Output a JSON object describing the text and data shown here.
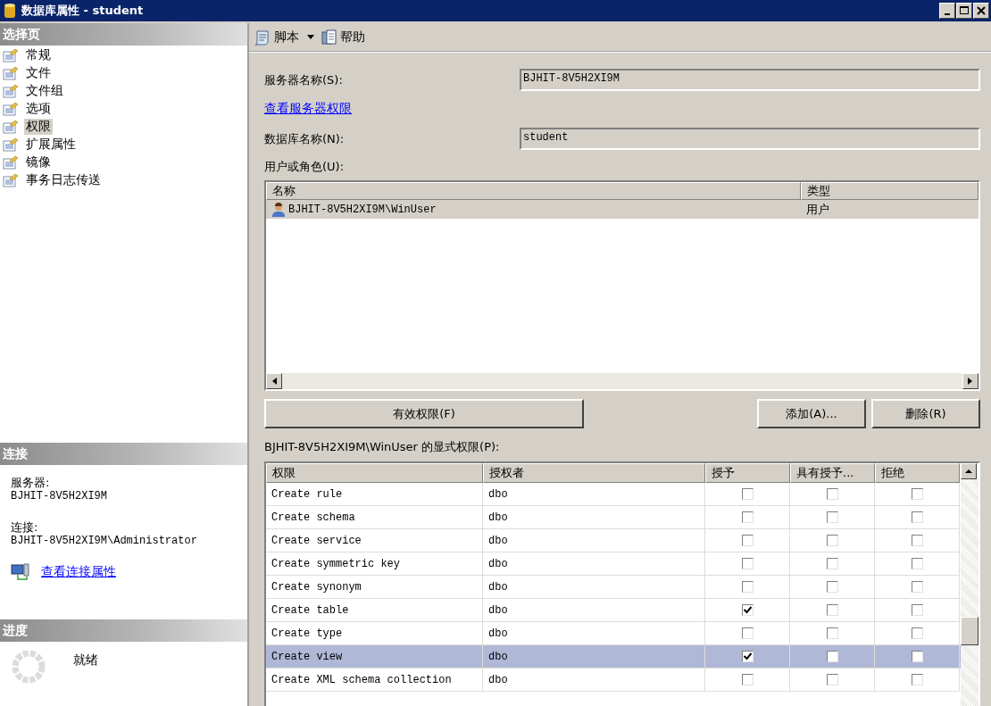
{
  "window": {
    "title": "数据库属性 - student"
  },
  "sidebar": {
    "header": "选择页",
    "items": [
      {
        "label": "常规",
        "selected": false
      },
      {
        "label": "文件",
        "selected": false
      },
      {
        "label": "文件组",
        "selected": false
      },
      {
        "label": "选项",
        "selected": false
      },
      {
        "label": "权限",
        "selected": true
      },
      {
        "label": "扩展属性",
        "selected": false
      },
      {
        "label": "镜像",
        "selected": false
      },
      {
        "label": "事务日志传送",
        "selected": false
      }
    ]
  },
  "connection": {
    "header": "连接",
    "server_label": "服务器:",
    "server": "BJHIT-8V5H2XI9M",
    "connection_label": "连接:",
    "connection": "BJHIT-8V5H2XI9M\\Administrator",
    "link": "查看连接属性"
  },
  "progress": {
    "header": "进度",
    "status": "就绪"
  },
  "toolbar": [
    {
      "kind": "script",
      "label": "脚本"
    },
    {
      "kind": "help",
      "label": "帮助"
    }
  ],
  "form": {
    "server_name_label": "服务器名称(S):",
    "server_name": "BJHIT-8V5H2XI9M",
    "server_perms_link": "查看服务器权限",
    "db_name_label": "数据库名称(N):",
    "db_name": "student",
    "users_label": "用户或角色(U):"
  },
  "users_table": {
    "columns": [
      "名称",
      "类型"
    ],
    "rows": [
      {
        "name": "BJHIT-8V5H2XI9M\\WinUser",
        "type": "用户",
        "selected": true
      }
    ]
  },
  "buttons": {
    "effective": "有效权限(F)",
    "add": "添加(A)...",
    "remove": "删除(R)"
  },
  "permissions": {
    "label": "BJHIT-8V5H2XI9M\\WinUser 的显式权限(P):",
    "columns": [
      "权限",
      "授权者",
      "授予",
      "具有授予...",
      "拒绝"
    ],
    "rows": [
      {
        "permission": "Create rule",
        "grantor": "dbo",
        "grant": false,
        "with_grant": false,
        "deny": false,
        "selected": false
      },
      {
        "permission": "Create schema",
        "grantor": "dbo",
        "grant": false,
        "with_grant": false,
        "deny": false,
        "selected": false
      },
      {
        "permission": "Create service",
        "grantor": "dbo",
        "grant": false,
        "with_grant": false,
        "deny": false,
        "selected": false
      },
      {
        "permission": "Create symmetric key",
        "grantor": "dbo",
        "grant": false,
        "with_grant": false,
        "deny": false,
        "selected": false
      },
      {
        "permission": "Create synonym",
        "grantor": "dbo",
        "grant": false,
        "with_grant": false,
        "deny": false,
        "selected": false
      },
      {
        "permission": "Create table",
        "grantor": "dbo",
        "grant": true,
        "with_grant": false,
        "deny": false,
        "selected": false
      },
      {
        "permission": "Create type",
        "grantor": "dbo",
        "grant": false,
        "with_grant": false,
        "deny": false,
        "selected": false
      },
      {
        "permission": "Create view",
        "grantor": "dbo",
        "grant": true,
        "with_grant": false,
        "deny": false,
        "selected": true
      },
      {
        "permission": "Create XML schema collection",
        "grantor": "dbo",
        "grant": false,
        "with_grant": false,
        "deny": false,
        "selected": false
      }
    ]
  }
}
